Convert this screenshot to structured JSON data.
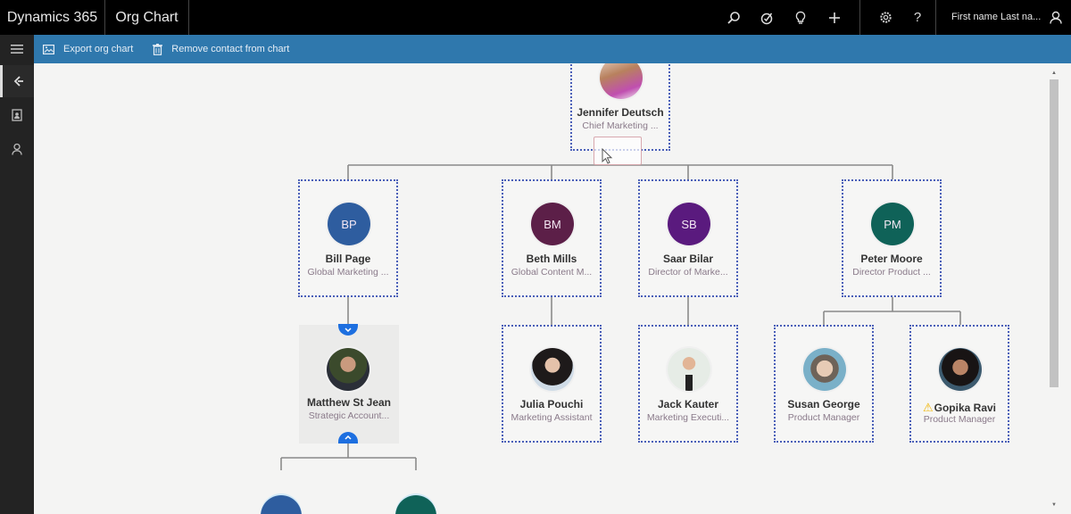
{
  "header": {
    "brand": "Dynamics 365",
    "area": "Org Chart",
    "icons": [
      "search-icon",
      "task-icon",
      "lightbulb-icon",
      "plus-icon",
      "gear-icon",
      "help-icon"
    ],
    "user_name": "First name Last na...",
    "user_icon": "person-icon"
  },
  "rail": {
    "items": [
      "hamburger-menu-icon",
      "back-icon",
      "contact-card-icon",
      "person-icon"
    ]
  },
  "commands": {
    "export_label": "Export org chart",
    "remove_label": "Remove contact from chart"
  },
  "org": {
    "root": {
      "name": "Jennifer Deutsch",
      "title": "Chief Marketing ...",
      "avatar_type": "photo"
    },
    "level1": [
      {
        "initials": "BP",
        "name": "Bill Page",
        "title": "Global Marketing ...",
        "color": "#2e5d9f"
      },
      {
        "initials": "BM",
        "name": "Beth Mills",
        "title": "Global Content M...",
        "color": "#5c1f48"
      },
      {
        "initials": "SB",
        "name": "Saar Bilar",
        "title": "Director of Marke...",
        "color": "#5a1a7e"
      },
      {
        "initials": "PM",
        "name": "Peter Moore",
        "title": "Director Product ...",
        "color": "#0f6258"
      }
    ],
    "level2": [
      {
        "name": "Matthew St Jean",
        "title": "Strategic Account...",
        "avatar_type": "photo",
        "expanded": true
      },
      {
        "name": "Julia Pouchi",
        "title": "Marketing Assistant",
        "avatar_type": "photo"
      },
      {
        "name": "Jack Kauter",
        "title": "Marketing Executi...",
        "avatar_type": "photo"
      },
      {
        "name": "Susan George",
        "title": "Product Manager",
        "avatar_type": "photo"
      },
      {
        "name": "Gopika Ravi",
        "title": "Product Manager",
        "avatar_type": "photo",
        "warning": true
      }
    ],
    "level3_colors": [
      "#2e5d9f",
      "#0f6258"
    ]
  },
  "colors": {
    "topbar": "#000000",
    "command_bar": "#2f78ad",
    "selection_border": "#4a5fb8",
    "toggle": "#1d6fe0"
  }
}
